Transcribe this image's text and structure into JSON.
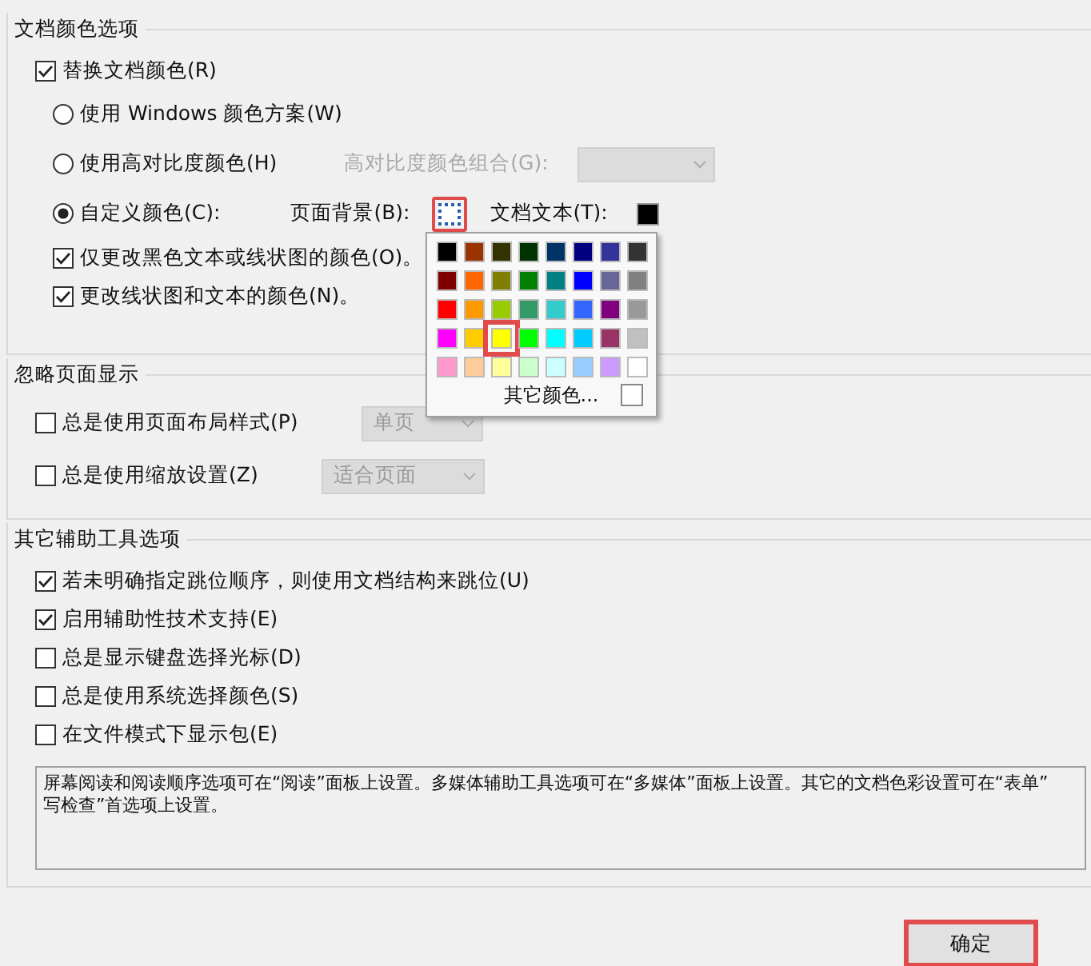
{
  "sections": [
    {
      "title": "文档颜色选项",
      "items": [
        {
          "kind": "checkbox",
          "label": "替换文档颜色(R)",
          "checked": true,
          "children": [
            {
              "kind": "radio",
              "label": "使用 Windows 颜色方案(W)",
              "selected": false
            },
            {
              "kind": "radio",
              "label": "使用高对比度颜色(H)",
              "selected": false,
              "combo": {
                "label": "高对比度颜色组合(G):",
                "disabled": true
              }
            },
            {
              "kind": "radio",
              "label": "自定义颜色(C):",
              "selected": true,
              "swatches": [
                {
                  "label": "页面背景(B):",
                  "color": "#ffffff",
                  "highlighted": true
                },
                {
                  "label": "文档文本(T):",
                  "color": "#000000",
                  "highlighted": false
                }
              ]
            },
            {
              "kind": "checkbox",
              "label": "仅更改黑色文本或线状图的颜色(O)。",
              "checked": true
            },
            {
              "kind": "checkbox",
              "label": "更改线状图和文本的颜色(N)。",
              "checked": true
            }
          ]
        }
      ]
    },
    {
      "title": "忽略页面显示",
      "items": [
        {
          "kind": "checkbox",
          "label": "总是使用页面布局样式(P)",
          "checked": false,
          "combo": {
            "value": "单页",
            "disabled": true
          }
        },
        {
          "kind": "checkbox",
          "label": "总是使用缩放设置(Z)",
          "checked": false,
          "combo": {
            "value": "适合页面",
            "disabled": true
          }
        }
      ]
    },
    {
      "title": "其它辅助工具选项",
      "items": [
        {
          "kind": "checkbox",
          "label": "若未明确指定跳位顺序，则使用文档结构来跳位(U)",
          "checked": true
        },
        {
          "kind": "checkbox",
          "label": "启用辅助性技术支持(E)",
          "checked": true
        },
        {
          "kind": "checkbox",
          "label": "总是显示键盘选择光标(D)",
          "checked": false
        },
        {
          "kind": "checkbox",
          "label": "总是使用系统选择颜色(S)",
          "checked": false
        },
        {
          "kind": "checkbox",
          "label": "在文件模式下显示包(E)",
          "checked": false
        }
      ],
      "note": [
        "屏幕阅读和阅读顺序选项可在“阅读”面板上设置。多媒体辅助工具选项可在“多媒体”面板上设置。其它的文档色彩设置可在“表单”",
        "写检查”首选项上设置。"
      ]
    }
  ],
  "color_popup": {
    "colors": [
      {
        "color": "#000000",
        "selected": false
      },
      {
        "color": "#993300",
        "selected": false
      },
      {
        "color": "#333300",
        "selected": false
      },
      {
        "color": "#003300",
        "selected": false
      },
      {
        "color": "#003366",
        "selected": false
      },
      {
        "color": "#000080",
        "selected": false
      },
      {
        "color": "#333399",
        "selected": false
      },
      {
        "color": "#333333",
        "selected": false
      },
      {
        "color": "#800000",
        "selected": false
      },
      {
        "color": "#ff6600",
        "selected": false
      },
      {
        "color": "#808000",
        "selected": false
      },
      {
        "color": "#008000",
        "selected": false
      },
      {
        "color": "#008080",
        "selected": false
      },
      {
        "color": "#0000ff",
        "selected": false
      },
      {
        "color": "#666699",
        "selected": false
      },
      {
        "color": "#808080",
        "selected": false
      },
      {
        "color": "#ff0000",
        "selected": false
      },
      {
        "color": "#ff9900",
        "selected": false
      },
      {
        "color": "#99cc00",
        "selected": false
      },
      {
        "color": "#339966",
        "selected": false
      },
      {
        "color": "#33cccc",
        "selected": false
      },
      {
        "color": "#3366ff",
        "selected": false
      },
      {
        "color": "#800080",
        "selected": false
      },
      {
        "color": "#999999",
        "selected": false
      },
      {
        "color": "#ff00ff",
        "selected": false
      },
      {
        "color": "#ffcc00",
        "selected": false
      },
      {
        "color": "#ffff00",
        "selected": true
      },
      {
        "color": "#00ff00",
        "selected": false
      },
      {
        "color": "#00ffff",
        "selected": false
      },
      {
        "color": "#00ccff",
        "selected": false
      },
      {
        "color": "#993366",
        "selected": false
      },
      {
        "color": "#c0c0c0",
        "selected": false
      },
      {
        "color": "#ff99cc",
        "selected": false
      },
      {
        "color": "#ffcc99",
        "selected": false
      },
      {
        "color": "#ffff99",
        "selected": false
      },
      {
        "color": "#ccffcc",
        "selected": false
      },
      {
        "color": "#ccffff",
        "selected": false
      },
      {
        "color": "#99ccff",
        "selected": false
      },
      {
        "color": "#cc99ff",
        "selected": false
      },
      {
        "color": "#ffffff",
        "selected": false
      }
    ],
    "more_label": "其它颜色..."
  },
  "buttons": [
    {
      "label": "确定",
      "highlighted": true
    }
  ]
}
